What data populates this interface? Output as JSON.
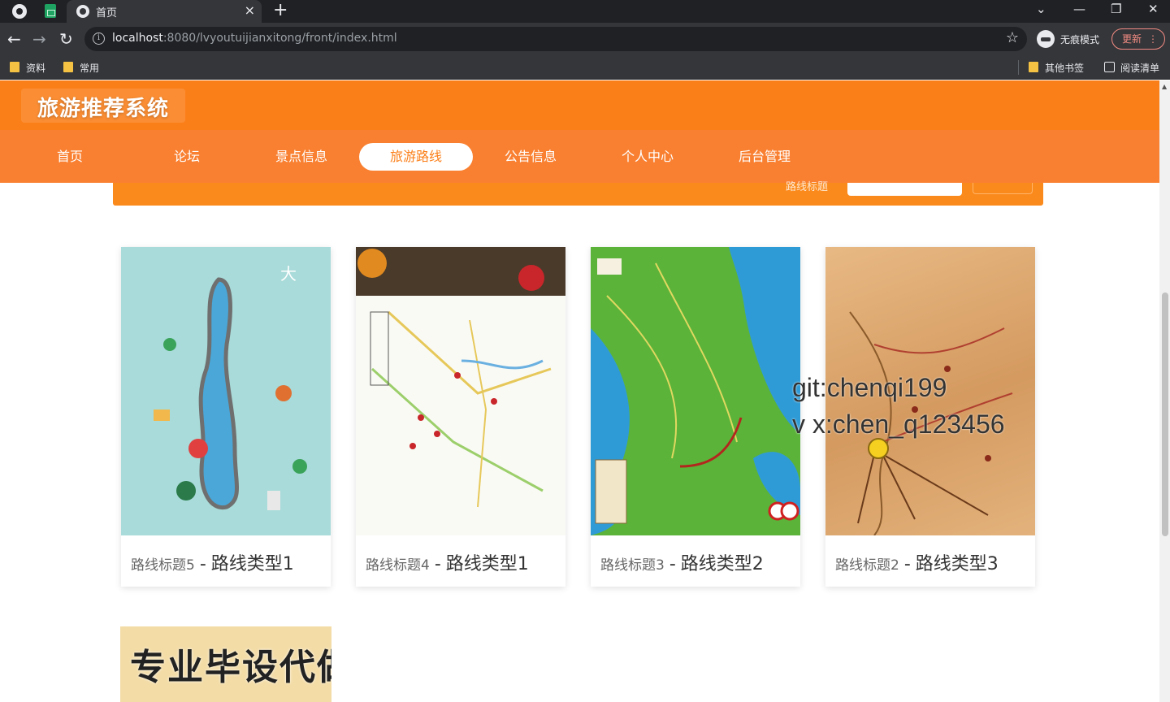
{
  "browser": {
    "tab_title": "首页",
    "tab_close": "×",
    "new_tab": "+",
    "url_host": "localhost",
    "url_rest": ":8080/lvyoutuijianxitong/front/index.html",
    "incognito_label": "无痕模式",
    "update_label": "更新",
    "menu_dots": "⋮",
    "back": "←",
    "forward": "→",
    "reload": "↻",
    "star": "☆",
    "info": "i",
    "window_controls": {
      "dropdown": "⌄",
      "minimize": "—",
      "restore": "❐",
      "close": "✕"
    },
    "bookmarks": [
      {
        "label": "资料"
      },
      {
        "label": "常用"
      }
    ],
    "bookmarks_right": [
      {
        "label": "其他书签"
      },
      {
        "label": "阅读清单"
      }
    ]
  },
  "site": {
    "title": "旅游推荐系统",
    "nav": [
      {
        "label": "首页",
        "active": false
      },
      {
        "label": "论坛",
        "active": false
      },
      {
        "label": "景点信息",
        "active": false
      },
      {
        "label": "旅游路线",
        "active": true
      },
      {
        "label": "公告信息",
        "active": false
      },
      {
        "label": "个人中心",
        "active": false
      },
      {
        "label": "后台管理",
        "active": false
      }
    ],
    "search_label": "路线标题"
  },
  "routes": [
    {
      "title": "路线标题5",
      "separator": "-",
      "type": "路线类型1",
      "image": "map-icon"
    },
    {
      "title": "路线标题4",
      "separator": "-",
      "type": "路线类型1",
      "image": "map-icon"
    },
    {
      "title": "路线标题3",
      "separator": "-",
      "type": "路线类型2",
      "image": "map-icon"
    },
    {
      "title": "路线标题2",
      "separator": "-",
      "type": "路线类型3",
      "image": "map-icon"
    }
  ],
  "overlay": {
    "line1": "git:chenqi199",
    "line2": "v x:chen_q123456",
    "ad": "专业毕设代做"
  },
  "colors": {
    "header": "#fb7f19",
    "nav": "#f98031",
    "active_text": "#fb7f19"
  }
}
